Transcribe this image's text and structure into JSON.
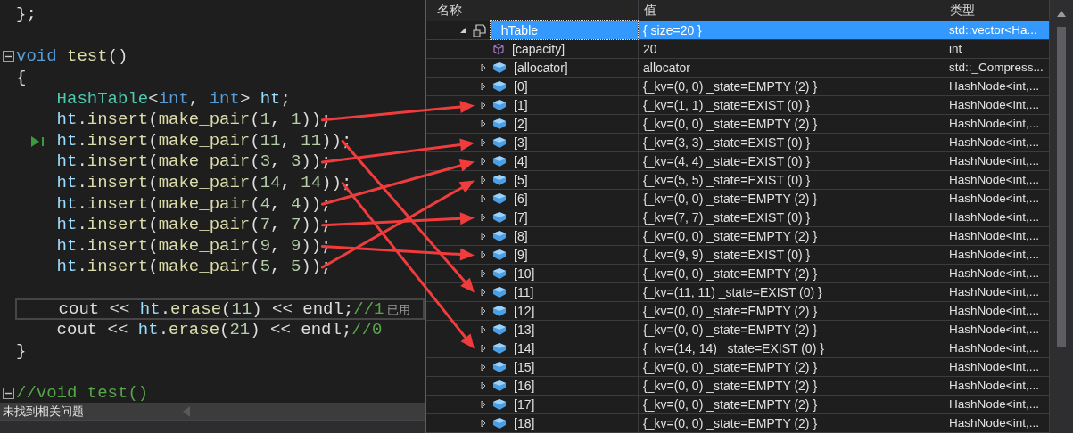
{
  "editor": {
    "lines": [
      {
        "kind": "code",
        "tokens": [
          {
            "t": "};",
            "kind": "plain"
          }
        ]
      },
      {
        "kind": "blank"
      },
      {
        "kind": "code",
        "marker": {
          "kind": "fold"
        },
        "tokens": [
          {
            "t": "void",
            "kind": "keyword"
          },
          {
            "t": " test",
            "kind": "func"
          },
          {
            "t": "()",
            "kind": "plain"
          }
        ]
      },
      {
        "kind": "code",
        "tokens": [
          {
            "t": "{",
            "kind": "plain"
          }
        ]
      },
      {
        "kind": "code",
        "tokens": [
          {
            "t": "    HashTable",
            "kind": "type"
          },
          {
            "t": "<",
            "kind": "plain"
          },
          {
            "t": "int",
            "kind": "keyword"
          },
          {
            "t": ", ",
            "kind": "plain"
          },
          {
            "t": "int",
            "kind": "keyword"
          },
          {
            "t": "> ",
            "kind": "plain"
          },
          {
            "t": "ht",
            "kind": "ident"
          },
          {
            "t": ";",
            "kind": "plain"
          }
        ]
      },
      {
        "kind": "code",
        "tokens": [
          {
            "t": "    ht",
            "kind": "ident"
          },
          {
            "t": ".",
            "kind": "plain"
          },
          {
            "t": "insert",
            "kind": "func"
          },
          {
            "t": "(",
            "kind": "plain"
          },
          {
            "t": "make_pair",
            "kind": "func"
          },
          {
            "t": "(",
            "kind": "plain"
          },
          {
            "t": "1",
            "kind": "number"
          },
          {
            "t": ", ",
            "kind": "plain"
          },
          {
            "t": "1",
            "kind": "number"
          },
          {
            "t": "));",
            "kind": "plain"
          }
        ]
      },
      {
        "kind": "code",
        "marker": {
          "kind": "next-statement"
        },
        "tokens": [
          {
            "t": "    ht",
            "kind": "ident"
          },
          {
            "t": ".",
            "kind": "plain"
          },
          {
            "t": "insert",
            "kind": "func"
          },
          {
            "t": "(",
            "kind": "plain"
          },
          {
            "t": "make_pair",
            "kind": "func"
          },
          {
            "t": "(",
            "kind": "plain"
          },
          {
            "t": "11",
            "kind": "number"
          },
          {
            "t": ", ",
            "kind": "plain"
          },
          {
            "t": "11",
            "kind": "number"
          },
          {
            "t": "));",
            "kind": "plain"
          }
        ]
      },
      {
        "kind": "code",
        "tokens": [
          {
            "t": "    ht",
            "kind": "ident"
          },
          {
            "t": ".",
            "kind": "plain"
          },
          {
            "t": "insert",
            "kind": "func"
          },
          {
            "t": "(",
            "kind": "plain"
          },
          {
            "t": "make_pair",
            "kind": "func"
          },
          {
            "t": "(",
            "kind": "plain"
          },
          {
            "t": "3",
            "kind": "number"
          },
          {
            "t": ", ",
            "kind": "plain"
          },
          {
            "t": "3",
            "kind": "number"
          },
          {
            "t": "));",
            "kind": "plain"
          }
        ]
      },
      {
        "kind": "code",
        "tokens": [
          {
            "t": "    ht",
            "kind": "ident"
          },
          {
            "t": ".",
            "kind": "plain"
          },
          {
            "t": "insert",
            "kind": "func"
          },
          {
            "t": "(",
            "kind": "plain"
          },
          {
            "t": "make_pair",
            "kind": "func"
          },
          {
            "t": "(",
            "kind": "plain"
          },
          {
            "t": "14",
            "kind": "number"
          },
          {
            "t": ", ",
            "kind": "plain"
          },
          {
            "t": "14",
            "kind": "number"
          },
          {
            "t": "));",
            "kind": "plain"
          }
        ]
      },
      {
        "kind": "code",
        "tokens": [
          {
            "t": "    ht",
            "kind": "ident"
          },
          {
            "t": ".",
            "kind": "plain"
          },
          {
            "t": "insert",
            "kind": "func"
          },
          {
            "t": "(",
            "kind": "plain"
          },
          {
            "t": "make_pair",
            "kind": "func"
          },
          {
            "t": "(",
            "kind": "plain"
          },
          {
            "t": "4",
            "kind": "number"
          },
          {
            "t": ", ",
            "kind": "plain"
          },
          {
            "t": "4",
            "kind": "number"
          },
          {
            "t": "));",
            "kind": "plain"
          }
        ]
      },
      {
        "kind": "code",
        "tokens": [
          {
            "t": "    ht",
            "kind": "ident"
          },
          {
            "t": ".",
            "kind": "plain"
          },
          {
            "t": "insert",
            "kind": "func"
          },
          {
            "t": "(",
            "kind": "plain"
          },
          {
            "t": "make_pair",
            "kind": "func"
          },
          {
            "t": "(",
            "kind": "plain"
          },
          {
            "t": "7",
            "kind": "number"
          },
          {
            "t": ", ",
            "kind": "plain"
          },
          {
            "t": "7",
            "kind": "number"
          },
          {
            "t": "));",
            "kind": "plain"
          }
        ]
      },
      {
        "kind": "code",
        "tokens": [
          {
            "t": "    ht",
            "kind": "ident"
          },
          {
            "t": ".",
            "kind": "plain"
          },
          {
            "t": "insert",
            "kind": "func"
          },
          {
            "t": "(",
            "kind": "plain"
          },
          {
            "t": "make_pair",
            "kind": "func"
          },
          {
            "t": "(",
            "kind": "plain"
          },
          {
            "t": "9",
            "kind": "number"
          },
          {
            "t": ", ",
            "kind": "plain"
          },
          {
            "t": "9",
            "kind": "number"
          },
          {
            "t": "));",
            "kind": "plain"
          }
        ]
      },
      {
        "kind": "code",
        "tokens": [
          {
            "t": "    ht",
            "kind": "ident"
          },
          {
            "t": ".",
            "kind": "plain"
          },
          {
            "t": "insert",
            "kind": "func"
          },
          {
            "t": "(",
            "kind": "plain"
          },
          {
            "t": "make_pair",
            "kind": "func"
          },
          {
            "t": "(",
            "kind": "plain"
          },
          {
            "t": "5",
            "kind": "number"
          },
          {
            "t": ", ",
            "kind": "plain"
          },
          {
            "t": "5",
            "kind": "number"
          },
          {
            "t": "));",
            "kind": "plain"
          }
        ]
      },
      {
        "kind": "blank"
      },
      {
        "kind": "current",
        "tokens": [
          {
            "t": "    cout << ",
            "kind": "plain"
          },
          {
            "t": "ht",
            "kind": "ident"
          },
          {
            "t": ".",
            "kind": "plain"
          },
          {
            "t": "erase",
            "kind": "func"
          },
          {
            "t": "(",
            "kind": "plain"
          },
          {
            "t": "11",
            "kind": "number"
          },
          {
            "t": ") << endl;",
            "kind": "plain"
          },
          {
            "t": "//1",
            "kind": "comment"
          },
          {
            "t": " 已用",
            "kind": "hint"
          }
        ]
      },
      {
        "kind": "code",
        "tokens": [
          {
            "t": "    cout << ",
            "kind": "plain"
          },
          {
            "t": "ht",
            "kind": "ident"
          },
          {
            "t": ".",
            "kind": "plain"
          },
          {
            "t": "erase",
            "kind": "func"
          },
          {
            "t": "(",
            "kind": "plain"
          },
          {
            "t": "21",
            "kind": "number"
          },
          {
            "t": ") << endl;",
            "kind": "plain"
          },
          {
            "t": "//0",
            "kind": "comment"
          }
        ]
      },
      {
        "kind": "code",
        "tokens": [
          {
            "t": "}",
            "kind": "plain"
          }
        ]
      },
      {
        "kind": "blank"
      },
      {
        "kind": "code",
        "marker": {
          "kind": "fold"
        },
        "tokens": [
          {
            "t": "//void test()",
            "kind": "comment"
          }
        ]
      }
    ]
  },
  "status_bar": {
    "text": "未找到相关问题"
  },
  "watch": {
    "columns": [
      "名称",
      "值",
      "类型"
    ],
    "root": {
      "name": "_hTable",
      "value": "{ size=20 }",
      "type": "std::vector<Ha...",
      "kind": "locked-field",
      "expanded": true,
      "selected": true,
      "children": [
        {
          "name": "[capacity]",
          "value": "20",
          "type": "int",
          "kind": "property",
          "selected": false
        },
        {
          "name": "[allocator]",
          "value": "allocator",
          "type": "std::_Compress...",
          "kind": "field",
          "selected": false
        },
        {
          "name": "[0]",
          "value": "{_kv=(0, 0) _state=EMPTY (2) }",
          "type": "HashNode<int,...",
          "kind": "field",
          "selected": false
        },
        {
          "name": "[1]",
          "value": "{_kv=(1, 1) _state=EXIST (0) }",
          "type": "HashNode<int,...",
          "kind": "field",
          "selected": false
        },
        {
          "name": "[2]",
          "value": "{_kv=(0, 0) _state=EMPTY (2) }",
          "type": "HashNode<int,...",
          "kind": "field",
          "selected": false
        },
        {
          "name": "[3]",
          "value": "{_kv=(3, 3) _state=EXIST (0) }",
          "type": "HashNode<int,...",
          "kind": "field",
          "selected": false
        },
        {
          "name": "[4]",
          "value": "{_kv=(4, 4) _state=EXIST (0) }",
          "type": "HashNode<int,...",
          "kind": "field",
          "selected": false
        },
        {
          "name": "[5]",
          "value": "{_kv=(5, 5) _state=EXIST (0) }",
          "type": "HashNode<int,...",
          "kind": "field",
          "selected": false
        },
        {
          "name": "[6]",
          "value": "{_kv=(0, 0) _state=EMPTY (2) }",
          "type": "HashNode<int,...",
          "kind": "field",
          "selected": false
        },
        {
          "name": "[7]",
          "value": "{_kv=(7, 7) _state=EXIST (0) }",
          "type": "HashNode<int,...",
          "kind": "field",
          "selected": false
        },
        {
          "name": "[8]",
          "value": "{_kv=(0, 0) _state=EMPTY (2) }",
          "type": "HashNode<int,...",
          "kind": "field",
          "selected": false
        },
        {
          "name": "[9]",
          "value": "{_kv=(9, 9) _state=EXIST (0) }",
          "type": "HashNode<int,...",
          "kind": "field",
          "selected": false
        },
        {
          "name": "[10]",
          "value": "{_kv=(0, 0) _state=EMPTY (2) }",
          "type": "HashNode<int,...",
          "kind": "field",
          "selected": false
        },
        {
          "name": "[11]",
          "value": "{_kv=(11, 11) _state=EXIST (0) }",
          "type": "HashNode<int,...",
          "kind": "field",
          "selected": false
        },
        {
          "name": "[12]",
          "value": "{_kv=(0, 0) _state=EMPTY (2) }",
          "type": "HashNode<int,...",
          "kind": "field",
          "selected": false
        },
        {
          "name": "[13]",
          "value": "{_kv=(0, 0) _state=EMPTY (2) }",
          "type": "HashNode<int,...",
          "kind": "field",
          "selected": false
        },
        {
          "name": "[14]",
          "value": "{_kv=(14, 14) _state=EXIST (0) }",
          "type": "HashNode<int,...",
          "kind": "field",
          "selected": false
        },
        {
          "name": "[15]",
          "value": "{_kv=(0, 0) _state=EMPTY (2) }",
          "type": "HashNode<int,...",
          "kind": "field",
          "selected": false
        },
        {
          "name": "[16]",
          "value": "{_kv=(0, 0) _state=EMPTY (2) }",
          "type": "HashNode<int,...",
          "kind": "field",
          "selected": false
        },
        {
          "name": "[17]",
          "value": "{_kv=(0, 0) _state=EMPTY (2) }",
          "type": "HashNode<int,...",
          "kind": "field",
          "selected": false
        },
        {
          "name": "[18]",
          "value": "{_kv=(0, 0) _state=EMPTY (2) }",
          "type": "HashNode<int,...",
          "kind": "field",
          "selected": false
        }
      ]
    }
  },
  "annotations": {
    "arrows_shown": true
  }
}
